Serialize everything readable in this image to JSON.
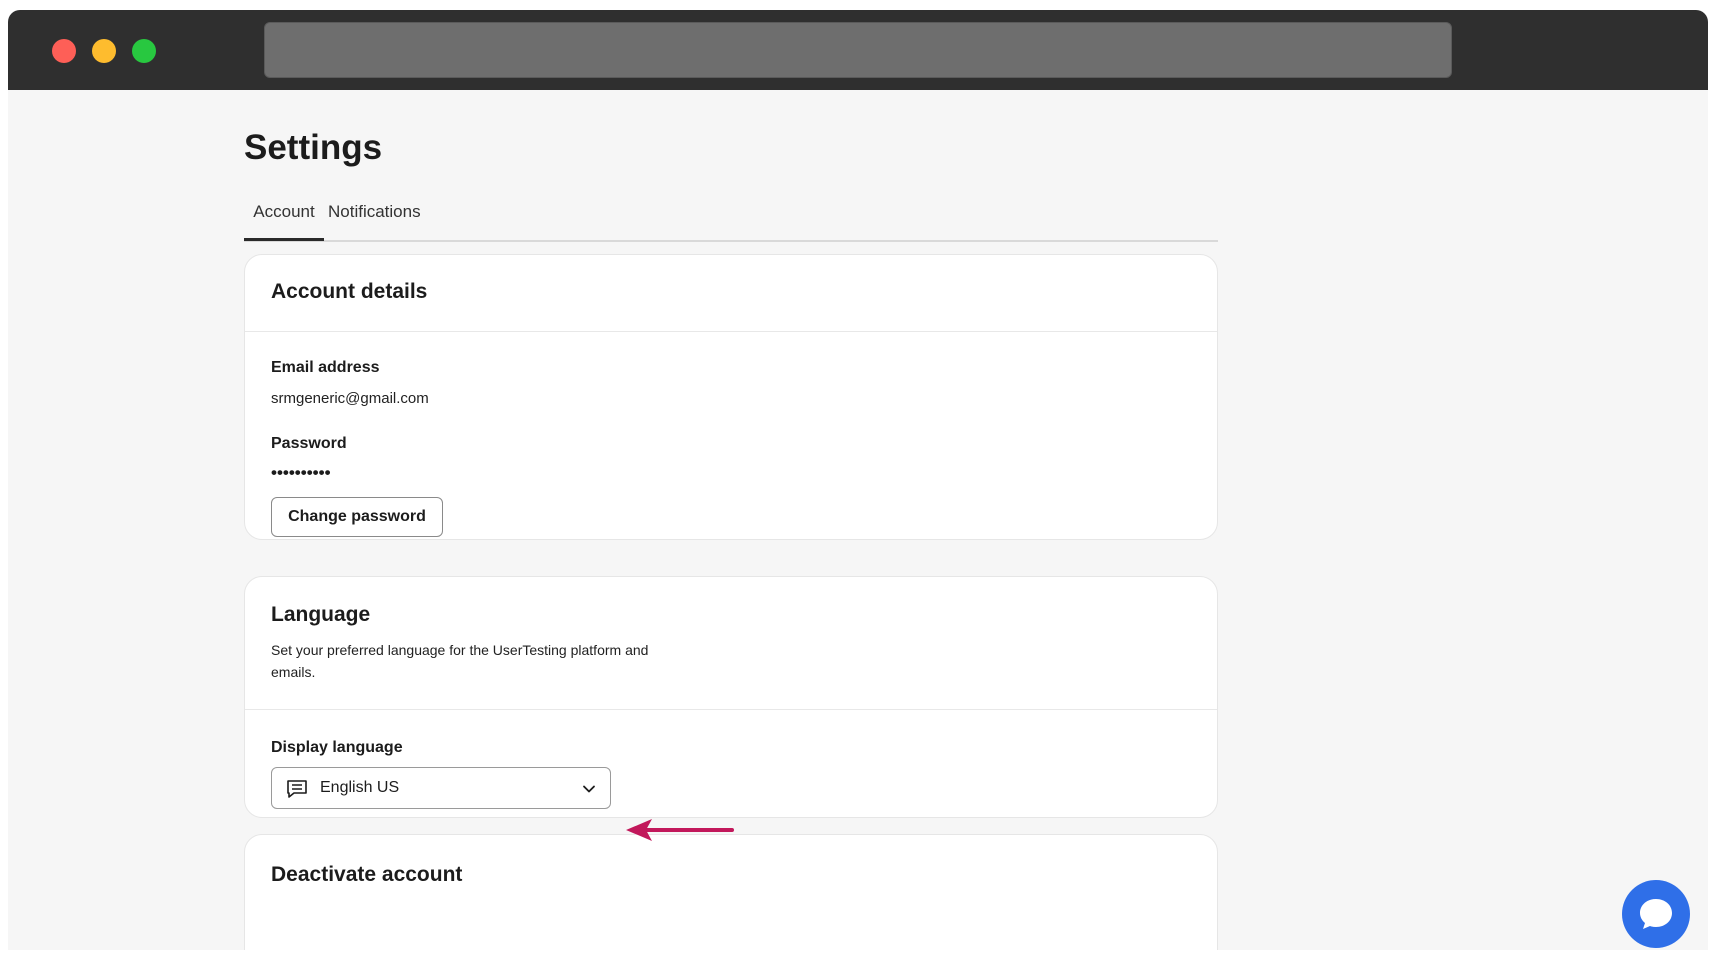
{
  "page": {
    "title": "Settings"
  },
  "tabs": [
    {
      "label": "Account",
      "active": true
    },
    {
      "label": "Notifications",
      "active": false
    }
  ],
  "account_details": {
    "title": "Account details",
    "email_label": "Email address",
    "email_value": "srmgeneric@gmail.com",
    "password_label": "Password",
    "password_value": "••••••••••",
    "change_password_label": "Change password"
  },
  "language": {
    "title": "Language",
    "description": "Set your preferred language for the UserTesting platform and emails.",
    "display_language_label": "Display language",
    "selected_value": "English US"
  },
  "deactivate": {
    "title": "Deactivate account"
  },
  "colors": {
    "accent_arrow": "#c2185b",
    "chat_button": "#2f6fe8",
    "titlebar": "#2f2f2f"
  },
  "icons": {
    "language_select": "chat-lines-icon",
    "dropdown": "chevron-down-icon",
    "chat": "chat-bubble-icon",
    "annotation": "arrow-left-icon"
  }
}
